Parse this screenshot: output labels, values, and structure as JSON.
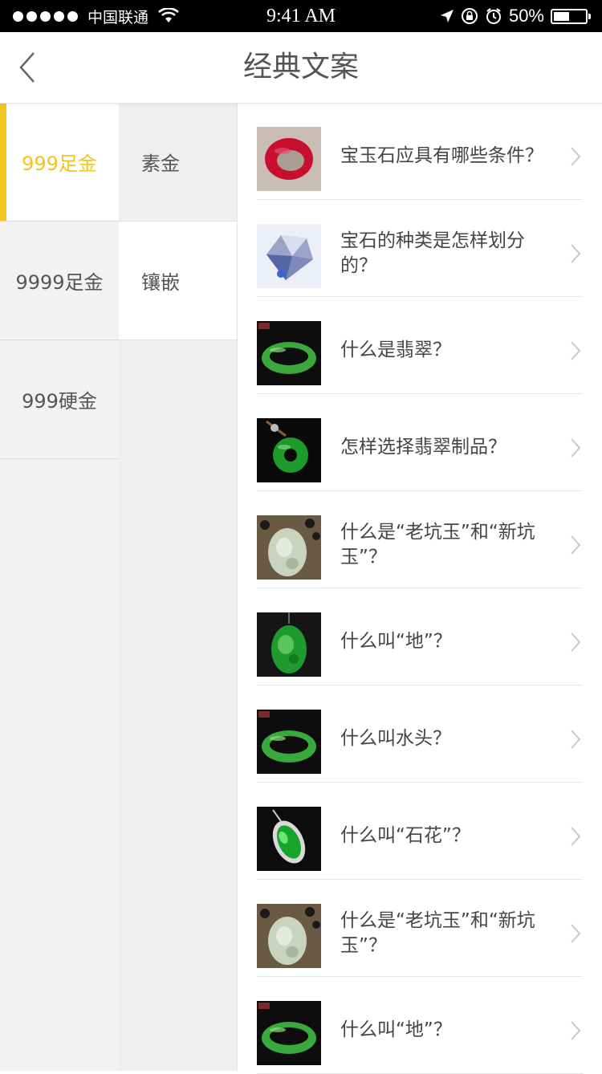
{
  "status_bar": {
    "carrier": "中国联通",
    "time": "9:41 AM",
    "battery": "50%",
    "battery_level": 0.5
  },
  "nav": {
    "title": "经典文案",
    "back_icon": "chevron-left-icon"
  },
  "sidebar": {
    "primary": [
      {
        "label": "999足金",
        "active": true
      },
      {
        "label": "9999足金",
        "active": false
      },
      {
        "label": "999硬金",
        "active": false
      }
    ],
    "secondary": [
      {
        "label": "素金",
        "active": false
      },
      {
        "label": "镶嵌",
        "active": true
      }
    ]
  },
  "articles": [
    {
      "title": "宝玉石应具有哪些条件？",
      "thumb": "red-bangle"
    },
    {
      "title": "宝石的种类是怎样划分的？",
      "thumb": "diamond"
    },
    {
      "title": "什么是翡翠？",
      "thumb": "green-bangle"
    },
    {
      "title": "怎样选择翡翠制品？",
      "thumb": "jade-donut-pendant"
    },
    {
      "title": "什么是“老坑玉”和“新坑玉”？",
      "thumb": "pale-jade-pendant"
    },
    {
      "title": "什么叫“地”？",
      "thumb": "green-jade-pendant"
    },
    {
      "title": "什么叫水头？",
      "thumb": "green-bangle"
    },
    {
      "title": "什么叫“石花”？",
      "thumb": "jade-silver-pendant"
    },
    {
      "title": "什么是“老坑玉”和“新坑玉”？",
      "thumb": "pale-jade-pendant"
    },
    {
      "title": "什么叫“地”？",
      "thumb": "green-bangle"
    }
  ],
  "colors": {
    "accent": "#f5c31d",
    "sidebar_bg": "#f2f2f2",
    "text": "#444444"
  }
}
